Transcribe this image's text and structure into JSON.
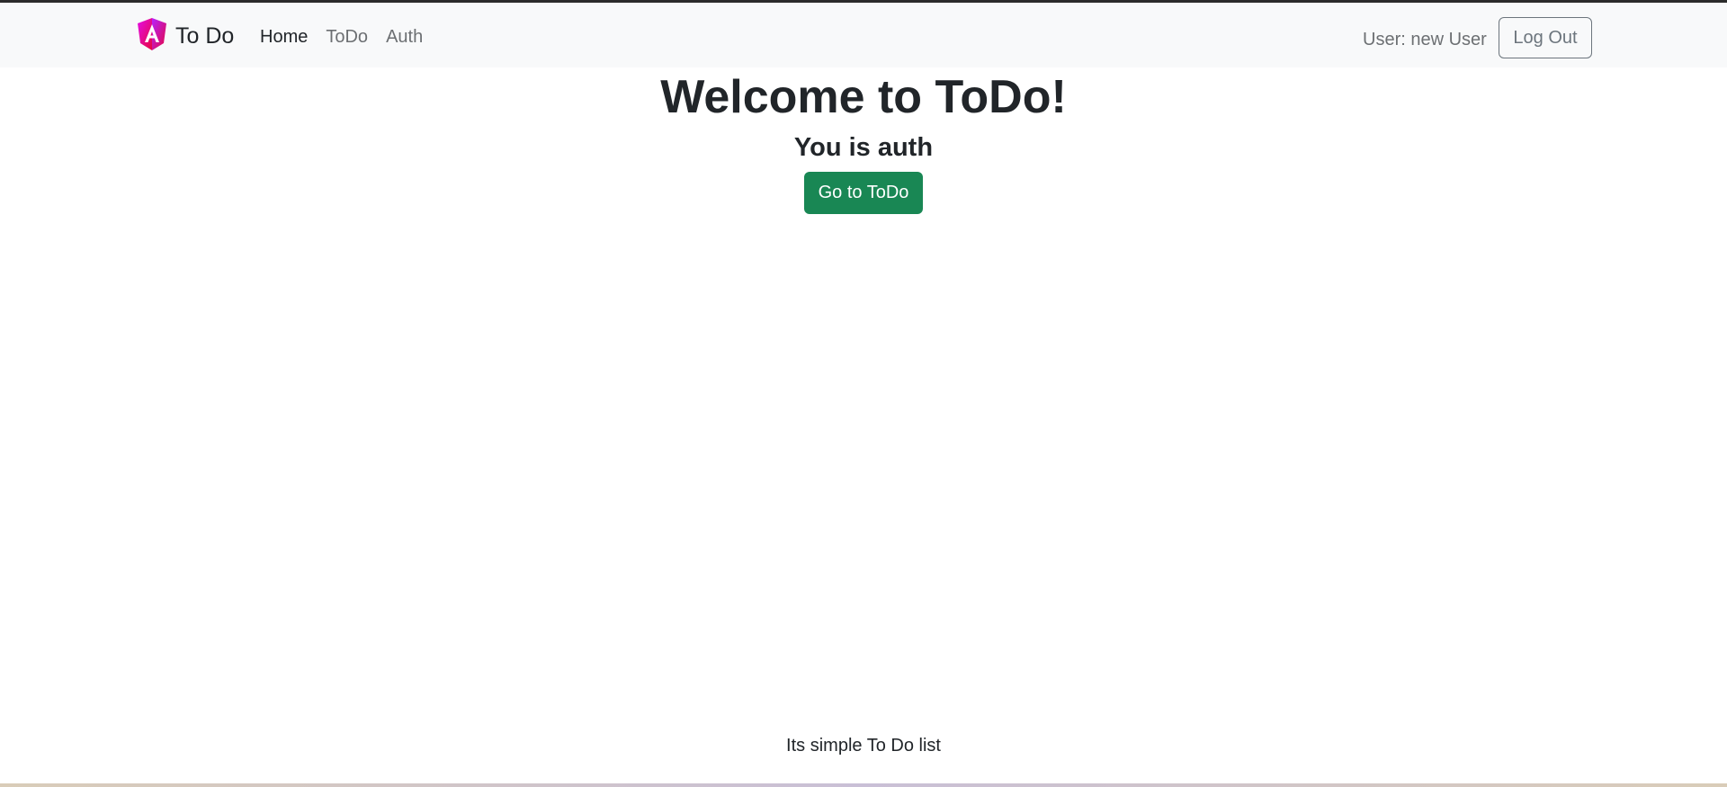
{
  "navbar": {
    "brand_text": "To Do",
    "brand_icon": "angular-logo-icon",
    "links": [
      {
        "label": "Home",
        "active": true
      },
      {
        "label": "ToDo",
        "active": false
      },
      {
        "label": "Auth",
        "active": false
      }
    ],
    "user_label": "User: new User",
    "logout_label": "Log Out"
  },
  "main": {
    "title": "Welcome to ToDo!",
    "status": "You is auth",
    "goto_button": "Go to ToDo"
  },
  "footer": {
    "text": "Its simple To Do list"
  },
  "colors": {
    "navbar_bg": "#f8f9fa",
    "success": "#198754",
    "secondary": "#6c757d",
    "logo_magenta": "#e40de8",
    "logo_red": "#e6073f"
  }
}
